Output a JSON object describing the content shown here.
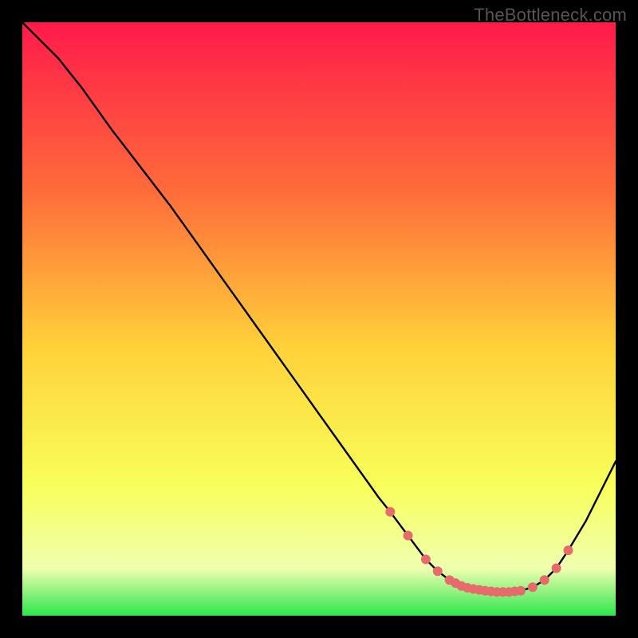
{
  "watermark": "TheBottleneck.com",
  "colors": {
    "black": "#000000",
    "line": "#000000",
    "marker": "#e86b6b",
    "gradient_top": "#ff1a4b",
    "gradient_upper_mid": "#ff6a3a",
    "gradient_mid": "#ffd23a",
    "gradient_lower_mid": "#f8ff5a",
    "gradient_pale": "#f0ffb0",
    "gradient_green": "#2ee54d"
  },
  "chart_data": {
    "type": "line",
    "title": "",
    "xlabel": "",
    "ylabel": "",
    "xlim": [
      0,
      100
    ],
    "ylim": [
      0,
      100
    ],
    "grid": false,
    "legend": false,
    "series": [
      {
        "name": "curve",
        "x": [
          0,
          4,
          6,
          10,
          15,
          20,
          25,
          30,
          35,
          40,
          45,
          50,
          55,
          60,
          62,
          65,
          68,
          70,
          72,
          74,
          76,
          78,
          80,
          82,
          84,
          86,
          88,
          90,
          92,
          95,
          98,
          100
        ],
        "y": [
          100,
          96,
          94,
          89,
          82,
          75.5,
          69,
          62,
          55,
          48,
          41,
          34,
          27,
          20,
          17.5,
          13.5,
          9.5,
          7.5,
          6,
          5,
          4.5,
          4.2,
          4,
          4,
          4.2,
          4.8,
          6,
          8,
          11,
          16,
          22,
          26
        ]
      }
    ],
    "markers": {
      "name": "highlight-points",
      "x": [
        62,
        65,
        68,
        70,
        72,
        73,
        74,
        75,
        76,
        77,
        78,
        79,
        80,
        81,
        82,
        83,
        84,
        86,
        88,
        90,
        92
      ],
      "y": [
        17.5,
        13.5,
        9.5,
        7.5,
        6,
        5.5,
        5,
        4.7,
        4.5,
        4.35,
        4.2,
        4.1,
        4,
        4,
        4,
        4.1,
        4.2,
        4.8,
        6,
        8,
        11
      ]
    }
  }
}
